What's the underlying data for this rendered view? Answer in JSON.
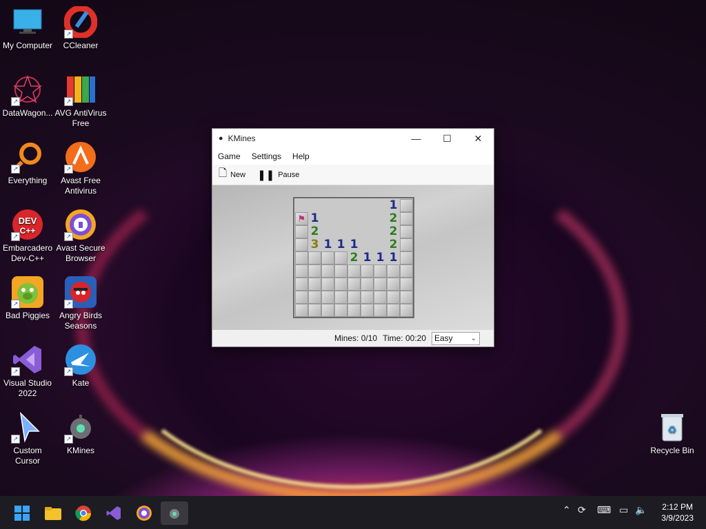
{
  "desktop": {
    "icons": [
      {
        "label": "My Computer",
        "icon": "monitor-icon"
      },
      {
        "label": "CCleaner",
        "icon": "ccleaner-icon"
      },
      {
        "label": "DataWagon...",
        "icon": "datawagon-icon"
      },
      {
        "label": "AVG AntiVirus Free",
        "icon": "avg-icon"
      },
      {
        "label": "Everything",
        "icon": "everything-search-icon"
      },
      {
        "label": "Avast Free Antivirus",
        "icon": "avast-icon"
      },
      {
        "label": "Embarcadero Dev-C++",
        "icon": "devcpp-icon"
      },
      {
        "label": "Avast Secure Browser",
        "icon": "avast-browser-icon"
      },
      {
        "label": "Bad Piggies",
        "icon": "bad-piggies-icon"
      },
      {
        "label": "Angry Birds Seasons",
        "icon": "angry-birds-icon"
      },
      {
        "label": "Visual Studio 2022",
        "icon": "visual-studio-icon"
      },
      {
        "label": "Kate",
        "icon": "kate-icon"
      },
      {
        "label": "Custom Cursor",
        "icon": "custom-cursor-icon"
      },
      {
        "label": "KMines",
        "icon": "kmines-icon"
      },
      {
        "label": "Recycle Bin",
        "icon": "recycle-bin-icon"
      }
    ]
  },
  "window": {
    "title": "KMines",
    "menu": [
      "Game",
      "Settings",
      "Help"
    ],
    "toolbar": {
      "new_label": "New",
      "pause_label": "Pause"
    },
    "board": {
      "rows": [
        [
          "",
          "",
          "",
          "",
          "",
          "",
          "",
          "1",
          "#"
        ],
        [
          "F",
          "1",
          "",
          "",
          "",
          "",
          "",
          "2",
          "#"
        ],
        [
          "#",
          "2",
          "",
          "",
          "",
          "",
          "",
          "2",
          "#"
        ],
        [
          "#",
          "3",
          "1",
          "1",
          "1",
          "",
          "",
          "2",
          "#"
        ],
        [
          "#",
          "#",
          "#",
          "#",
          "2",
          "1",
          "1",
          "1",
          "#"
        ],
        [
          "#",
          "#",
          "#",
          "#",
          "#",
          "#",
          "#",
          "#",
          "#"
        ],
        [
          "#",
          "#",
          "#",
          "#",
          "#",
          "#",
          "#",
          "#",
          "#"
        ],
        [
          "#",
          "#",
          "#",
          "#",
          "#",
          "#",
          "#",
          "#",
          "#"
        ],
        [
          "#",
          "#",
          "#",
          "#",
          "#",
          "#",
          "#",
          "#",
          "#"
        ]
      ]
    },
    "status": {
      "mines": "Mines: 0/10",
      "time": "Time: 00:20",
      "difficulty": "Easy"
    }
  },
  "taskbar": {
    "apps": [
      "start-icon",
      "file-explorer-icon",
      "chrome-icon",
      "visual-studio-icon",
      "avast-browser-icon",
      "kmines-icon"
    ],
    "clock": {
      "time": "2:12 PM",
      "date": "3/9/2023"
    }
  }
}
